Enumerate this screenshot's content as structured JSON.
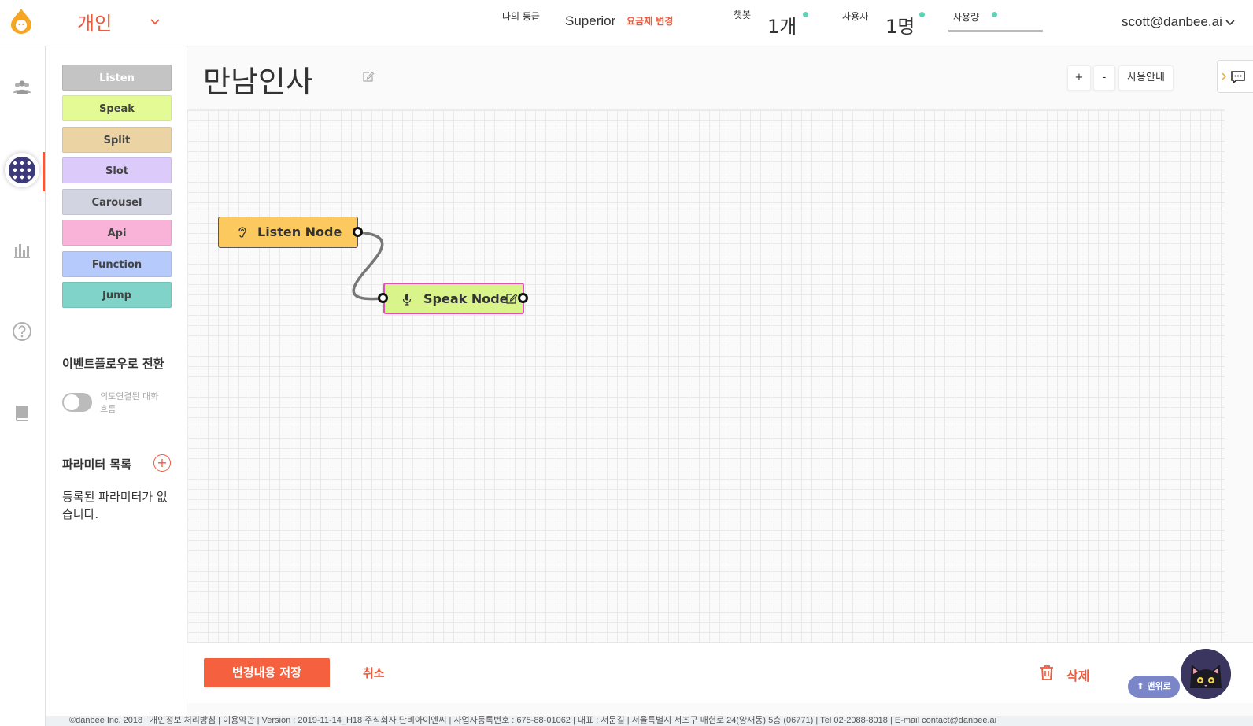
{
  "header": {
    "workspace": "개인",
    "grade_label": "나의 등급",
    "grade_value": "Superior",
    "plan_change": "요금제 변경",
    "chatbot_label": "챗봇",
    "chatbot_count": "1개",
    "user_label": "사용자",
    "user_count": "1명",
    "usage_label": "사용량",
    "user_email": "scott@danbee.ai"
  },
  "palette": [
    {
      "label": "Listen",
      "color": "#c4c4c4",
      "text": "#ffffff"
    },
    {
      "label": "Speak",
      "color": "#e4fb95",
      "text": "#444444"
    },
    {
      "label": "Split",
      "color": "#ecd3a4",
      "text": "#444444"
    },
    {
      "label": "Slot",
      "color": "#dccafb",
      "text": "#444444"
    },
    {
      "label": "Carousel",
      "color": "#d3d4e2",
      "text": "#444444"
    },
    {
      "label": "Api",
      "color": "#f9b2d8",
      "text": "#444444"
    },
    {
      "label": "Function",
      "color": "#b6cbfb",
      "text": "#444444"
    },
    {
      "label": "Jump",
      "color": "#7fd3c8",
      "text": "#444444"
    }
  ],
  "sidebar": {
    "eventflow_title": "이벤트플로우로 전환",
    "toggle_label": "의도연결된 대화흐름",
    "params_title": "파라미터 목록",
    "params_empty": "등록된 파라미터가 없습니다."
  },
  "main": {
    "title": "만남인사",
    "zoom_in": "+",
    "zoom_out": "-",
    "guide": "사용안내"
  },
  "nodes": {
    "listen": "Listen Node",
    "speak": "Speak Node"
  },
  "actions": {
    "save": "변경내용 저장",
    "cancel": "취소",
    "delete": "삭제",
    "to_top": "⬆ 맨위로"
  },
  "footer": "©danbee Inc. 2018 | 개인정보 처리방침 | 이용약관 | Version : 2019-11-14_H18      주식회사 단비아이엔씨 | 사업자등록번호 : 675-88-01062 | 대표 : 서문길 | 서울특별시 서초구 매헌로 24(양재동) 5층 (06771) | Tel 02-2088-8018 | E-mail contact@danbee.ai",
  "colors": {
    "accent": "#f05a3c",
    "listen_node": "#fbc95e",
    "speak_node": "#d9f48a",
    "speak_border": "#e44fb0"
  }
}
